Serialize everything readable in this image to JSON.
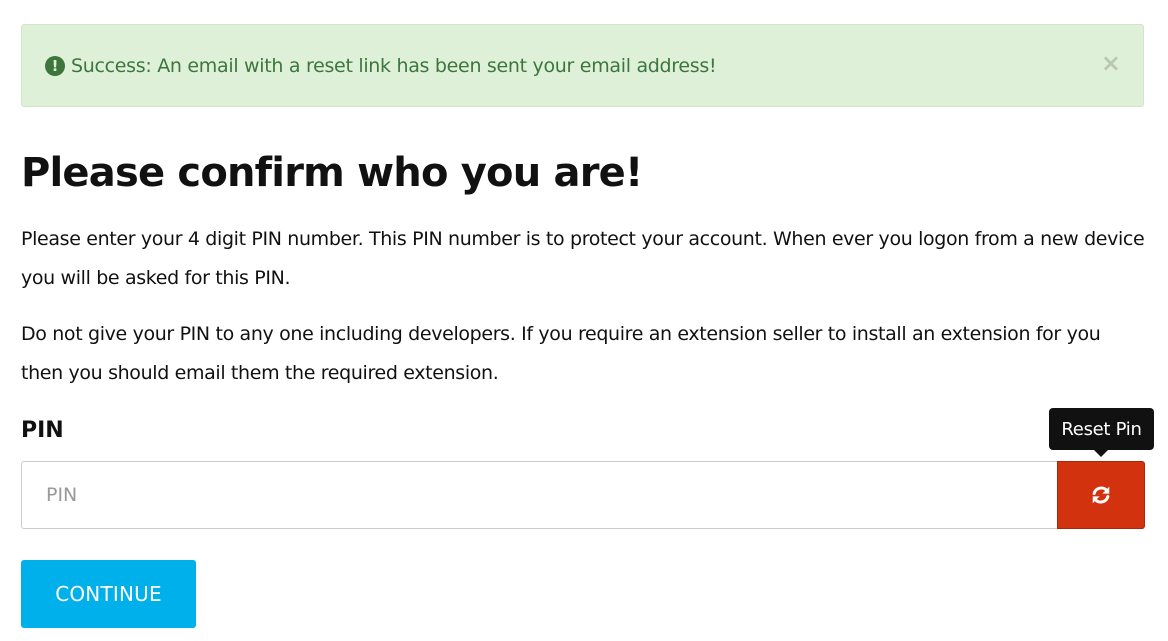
{
  "alert": {
    "icon": "exclamation-circle-icon",
    "message": "Success: An email with a reset link has been sent your email address!",
    "close_glyph": "×",
    "color": "#3c763d",
    "background": "#dff0d8"
  },
  "page": {
    "title": "Please confirm who you are!",
    "paragraph1": "Please enter your 4 digit PIN number. This PIN number is to protect your account. When ever you logon from a new device you will be asked for this PIN.",
    "paragraph2": "Do not give your PIN to any one including developers. If you require an extension seller to install an extension for you then you should email them the required extension."
  },
  "pin": {
    "label": "PIN",
    "value": "",
    "placeholder": "PIN",
    "reset_icon": "refresh-icon",
    "reset_tooltip": "Reset Pin",
    "reset_color": "#d3320f"
  },
  "actions": {
    "continue_label": "CONTINUE",
    "continue_color": "#00b0ea"
  }
}
